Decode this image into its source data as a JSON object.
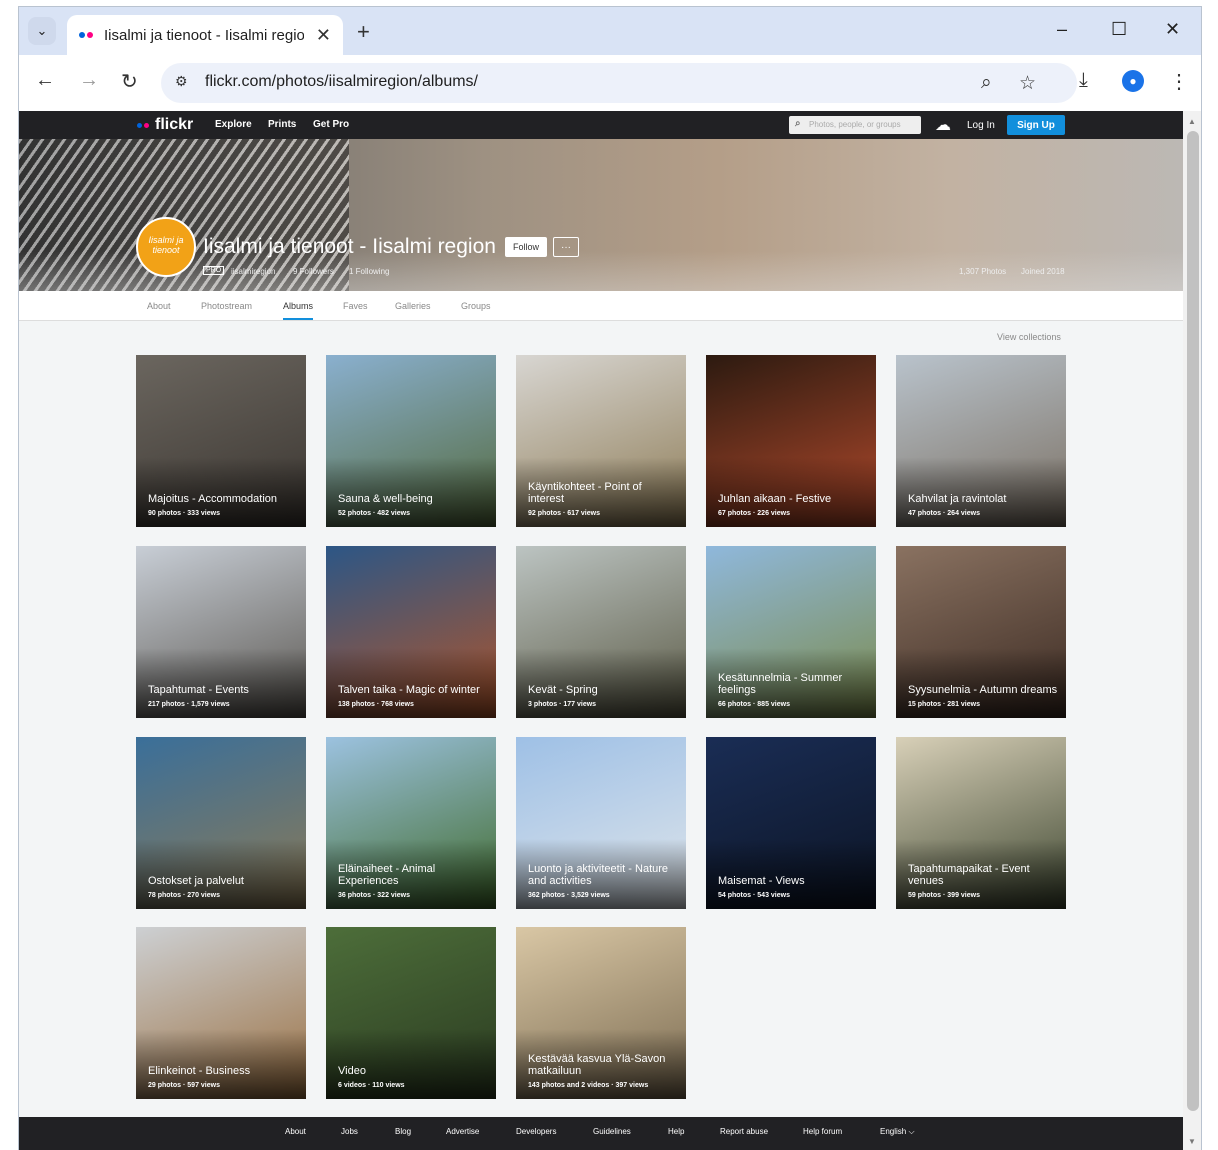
{
  "browser": {
    "tab_title": "Iisalmi ja tienoot - Iisalmi region",
    "url": "flickr.com/photos/iisalmiregion/albums/"
  },
  "flickr_nav": {
    "logo": "flickr",
    "links": [
      "Explore",
      "Prints",
      "Get Pro"
    ],
    "search_placeholder": "Photos, people, or groups",
    "login": "Log In",
    "signup": "Sign Up"
  },
  "profile": {
    "buddy_text": "Iisalmi ja tienoot",
    "name": "Iisalmi ja tienoot - Iisalmi region",
    "follow": "Follow",
    "more": "···",
    "pro": "PRO",
    "username": "iisalmiregion",
    "followers": "9 Followers",
    "following": "1 Following",
    "photos": "1,307 Photos",
    "joined": "Joined 2018"
  },
  "subnav": [
    "About",
    "Photostream",
    "Albums",
    "Faves",
    "Galleries",
    "Groups"
  ],
  "view_collections": "View collections",
  "albums": [
    {
      "title": "Majoitus - Accommodation",
      "meta": "90 photos · 333 views",
      "colors": [
        "#6b665f",
        "#3a3530"
      ]
    },
    {
      "title": "Sauna & well-being",
      "meta": "52 photos · 482 views",
      "colors": [
        "#8ab0cf",
        "#52683a"
      ]
    },
    {
      "title": "Käyntikohteet - Point of interest",
      "meta": "92 photos · 617 views",
      "colors": [
        "#d8d6d2",
        "#8d7b55"
      ]
    },
    {
      "title": "Juhlan aikaan - Festive",
      "meta": "67 photos · 226 views",
      "colors": [
        "#2c1a10",
        "#b34a2c"
      ]
    },
    {
      "title": "Kahvilat ja ravintolat",
      "meta": "47 photos · 264 views",
      "colors": [
        "#b9c3cc",
        "#7a6f62"
      ]
    },
    {
      "title": "Tapahtumat - Events",
      "meta": "217 photos · 1,579 views",
      "colors": [
        "#c8ced6",
        "#5a5650"
      ]
    },
    {
      "title": "Talven taika - Magic of winter",
      "meta": "138 photos · 768 views",
      "colors": [
        "#2c5686",
        "#b0552a"
      ]
    },
    {
      "title": "Kevät - Spring",
      "meta": "3 photos · 177 views",
      "colors": [
        "#bcc4c2",
        "#5b5a45"
      ]
    },
    {
      "title": "Kesätunnelmia - Summer feelings",
      "meta": "66 photos · 885 views",
      "colors": [
        "#8fb8dc",
        "#7b8a4a"
      ]
    },
    {
      "title": "Syysunelmia - Autumn dreams",
      "meta": "15 photos · 281 views",
      "colors": [
        "#8a7261",
        "#3b2a22"
      ]
    },
    {
      "title": "Ostokset ja palvelut",
      "meta": "78 photos · 270 views",
      "colors": [
        "#3a6f9a",
        "#8c7a55"
      ]
    },
    {
      "title": "Eläinaiheet - Animal Experiences",
      "meta": "36 photos · 322 views",
      "colors": [
        "#9cc2e0",
        "#3f6a2a"
      ]
    },
    {
      "title": "Luonto ja aktiviteetit - Nature and activities",
      "meta": "362 photos · 3,529 views",
      "colors": [
        "#9ec0e6",
        "#dfe5ea"
      ]
    },
    {
      "title": "Maisemat - Views",
      "meta": "54 photos · 543 views",
      "colors": [
        "#1a2d55",
        "#0c1424"
      ]
    },
    {
      "title": "Tapahtumapaikat - Event venues",
      "meta": "59 photos · 399 views",
      "colors": [
        "#d8d0b8",
        "#3d4630"
      ]
    },
    {
      "title": "Elinkeinot - Business",
      "meta": "29 photos · 597 views",
      "colors": [
        "#cdd0d3",
        "#9a6f40"
      ]
    },
    {
      "title": "Video",
      "meta": "6 videos · 110 views",
      "colors": [
        "#4d6e3a",
        "#2a3a20"
      ]
    },
    {
      "title": "Kestävää kasvua Ylä-Savon matkailuun",
      "meta": "143 photos and 2 videos · 397 views",
      "colors": [
        "#d9c7a5",
        "#7a6a50"
      ]
    }
  ],
  "footer": [
    "About",
    "Jobs",
    "Blog",
    "Advertise",
    "Developers",
    "Guidelines",
    "Help",
    "Report abuse",
    "Help forum",
    "English ⌵"
  ]
}
